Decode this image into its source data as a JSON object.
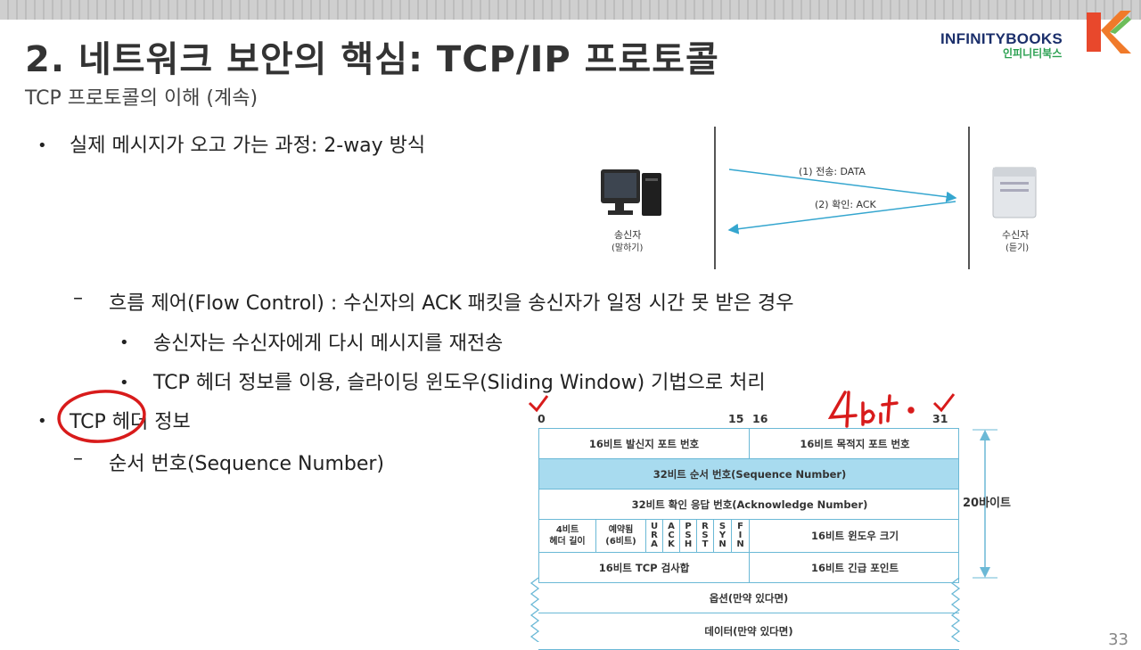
{
  "slide": {
    "title": "2. 네트워크 보안의 핵심: TCP/IP 프로토콜",
    "subtitle": "TCP 프로토콜의 이해 (계속)",
    "page_number": "33"
  },
  "logo": {
    "name_en": "INFINITYBOOKS",
    "name_ko": "인피니티북스",
    "brand_color": "#1b2f6b",
    "accent_color": "#f07a2a"
  },
  "bullets": {
    "b1": "실제 메시지가 오고 가는 과정: 2-way 방식",
    "b1_sub": "흐름 제어(Flow Control) : 수신자의 ACK 패킷을 송신자가 일정 시간 못 받은 경우",
    "b1_sub_a": "송신자는 수신자에게 다시 메시지를 재전송",
    "b1_sub_b": "TCP 헤더 정보를 이용, 슬라이딩 윈도우(Sliding Window) 기법으로 처리",
    "b2": "TCP 헤더 정보",
    "b2_sub": "순서 번호(Sequence Number)",
    "bullet_glyph": "•",
    "dash_glyph": "–"
  },
  "diagram": {
    "arrow1": "(1) 전송: DATA",
    "arrow2": "(2) 확인: ACK",
    "sender": "송신자",
    "sender_sub": "(말하기)",
    "receiver": "수신자",
    "receiver_sub": "(듣기)",
    "arrow_color": "#35a6cf"
  },
  "header_table": {
    "bits": {
      "b0": "0",
      "b15": "15",
      "b16": "16",
      "b31": "31"
    },
    "row1_left": "16비트 발신지 포트 번호",
    "row1_right": "16비트 목적지 포트 번호",
    "row2": "32비트 순서 번호(Sequence Number)",
    "row3": "32비트 확인 응답 번호(Acknowledge Number)",
    "row4_hlen": "4비트\n헤더 길이",
    "row4_reserved": "예약됨\n(6비트)",
    "flags": [
      "URA",
      "ACK",
      "PSH",
      "RST",
      "SYN",
      "FIN"
    ],
    "row4_window": "16비트 윈도우 크기",
    "row5_left": "16비트 TCP 검사합",
    "row5_right": "16비트 긴급 포인트",
    "options": "옵션(만약 있다면)",
    "data": "데이터(만약 있다면)",
    "size_label": "20바이트",
    "highlight_color": "#a8dbef",
    "border_color": "#6bb9d6"
  },
  "annotations": {
    "handwritten": "4bit",
    "ink_color": "#d81b1b"
  }
}
